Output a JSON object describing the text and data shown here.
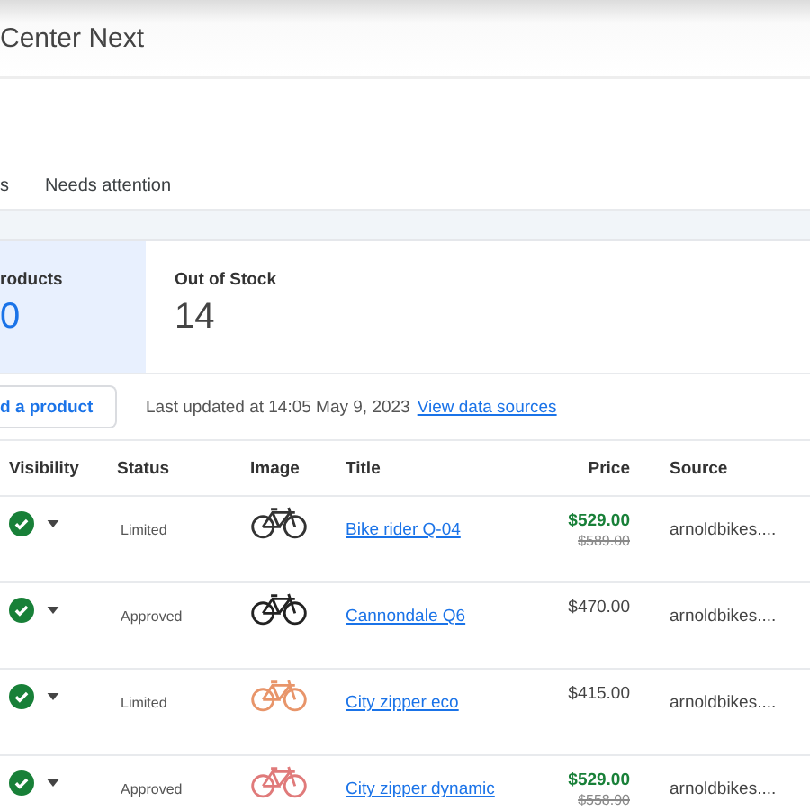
{
  "header": {
    "title": "Center Next"
  },
  "tabs": [
    {
      "label": "s",
      "selected": false
    },
    {
      "label": "Needs attention",
      "selected": false
    }
  ],
  "cards": [
    {
      "label": "roducts",
      "value": "0",
      "selected": true
    },
    {
      "label": "Out of Stock",
      "value": "14",
      "selected": false
    }
  ],
  "toolbar": {
    "button": "d a product",
    "updated": "Last updated at 14:05 May 9, 2023",
    "link": "View data sources"
  },
  "table": {
    "columns": [
      "Visibility",
      "Status",
      "Image",
      "Title",
      "Price",
      "Source"
    ],
    "rows": [
      {
        "visible": true,
        "status": "Limited",
        "color": "#333333",
        "title": "Bike rider Q-04",
        "price": "$529.00",
        "original_price": "$589.00",
        "source": "arnoldbikes...."
      },
      {
        "visible": true,
        "status": "Approved",
        "color": "#222222",
        "title": "Cannondale Q6",
        "price": "$470.00",
        "source": "arnoldbikes...."
      },
      {
        "visible": true,
        "status": "Limited",
        "color": "#e8956a",
        "title": "City zipper eco",
        "price": "$415.00",
        "source": "arnoldbikes...."
      },
      {
        "visible": true,
        "status": "Approved",
        "color": "#e07a7a",
        "title": "City zipper dynamic",
        "price": "$529.00",
        "original_price": "$558.90",
        "source": "arnoldbikes...."
      }
    ]
  }
}
